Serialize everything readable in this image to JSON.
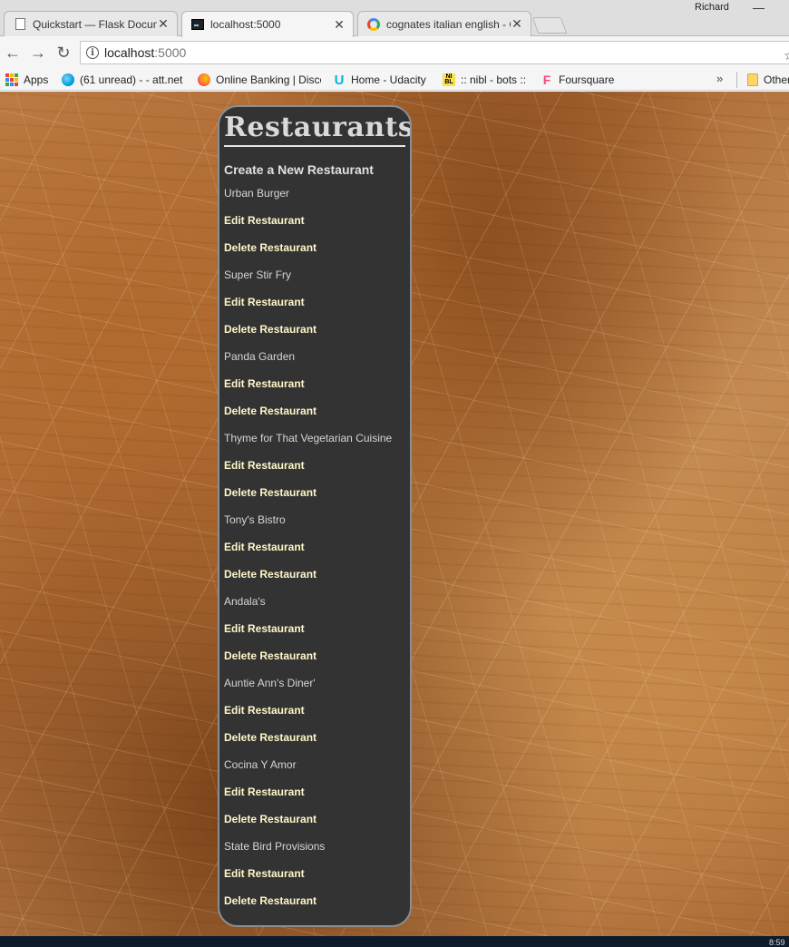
{
  "browser": {
    "tabs": [
      {
        "title": "Quickstart — Flask Documentation",
        "favicon": "document-icon",
        "active": false
      },
      {
        "title": "localhost:5000",
        "favicon": "terminal-icon",
        "active": true
      },
      {
        "title": "cognates italian english - Google Search",
        "favicon": "google-icon",
        "active": false
      }
    ],
    "profile_name": "Richard",
    "url_host": "localhost",
    "url_port": ":5000",
    "bookmarks": [
      {
        "label": "Apps",
        "icon": "apps-grid-icon"
      },
      {
        "label": "(61 unread) - - att.net",
        "icon": "att-icon"
      },
      {
        "label": "Online Banking | Discover",
        "icon": "firefox-icon"
      },
      {
        "label": "Home - Udacity",
        "icon": "udacity-icon"
      },
      {
        "label": ":: nibl - bots ::",
        "icon": "nibl-icon"
      },
      {
        "label": "Foursquare",
        "icon": "foursquare-icon"
      },
      {
        "label": "Other bookmarks",
        "icon": "folder-icon"
      }
    ],
    "more_bookmarks": "»"
  },
  "page": {
    "heading": "Restaurants",
    "create_link": "Create a New Restaurant",
    "edit_label": "Edit Restaurant",
    "delete_label": "Delete Restaurant",
    "restaurants": [
      "Urban Burger",
      "Super Stir Fry",
      "Panda Garden",
      "Thyme for That Vegetarian Cuisine",
      "Tony's Bistro",
      "Andala's",
      "Auntie Ann's Diner'",
      "Cocina Y Amor",
      "State Bird Provisions"
    ]
  },
  "taskbar": {
    "clock": "8:59"
  }
}
